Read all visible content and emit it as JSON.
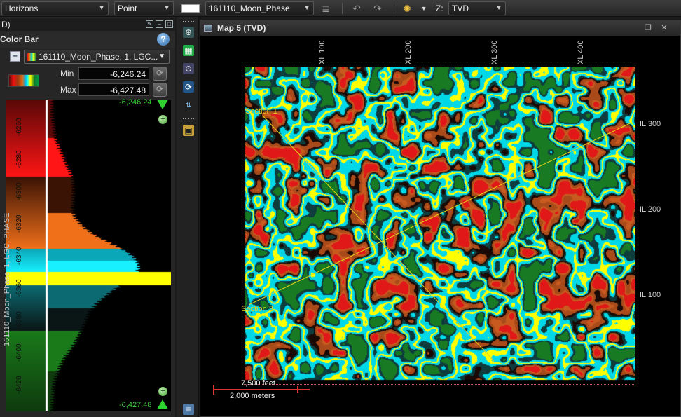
{
  "toolbar": {
    "horizons_label": "Horizons",
    "point_label": "Point",
    "attribute_label": "161110_Moon_Phase",
    "z_prefix": "Z:",
    "z_label": "TVD"
  },
  "left_panel": {
    "header_text": "D)",
    "title": "Color Bar",
    "attribute_select": "161110_Moon_Phase, 1, LGC...",
    "min_label": "Min",
    "min_value": "-6,246.24",
    "max_label": "Max",
    "max_value": "-6,427.48",
    "top_value": "-6,246.24",
    "bottom_value": "-6,427.48",
    "side_caption": "161110_Moon_Phase, 1, LGC, PHASE",
    "tick_labels": [
      "-6260",
      "-6280",
      "-6300",
      "-6320",
      "-6340",
      "-6360",
      "-6380",
      "-6400",
      "-6420"
    ]
  },
  "map": {
    "title": "Map 5 (TVD)",
    "xl_labels": [
      "XL 100",
      "XL 200",
      "XL 300",
      "XL 400"
    ],
    "il_labels": [
      "IL 300",
      "IL 200",
      "IL 100"
    ],
    "section_labels": [
      "Section 1",
      "Section 3"
    ],
    "scale_feet": "7,500 feet",
    "scale_meters": "2,000 meters"
  },
  "colors": {
    "ramp": [
      "#e01010",
      "#e46a10",
      "#18c8d8",
      "#ffff00",
      "#0e2a2a",
      "#1f8a1f"
    ],
    "map_palette": [
      "#ffff00",
      "#00d8e8",
      "#0f3d3d",
      "#a84a1a",
      "#1a0a05",
      "#e01818",
      "#187a22",
      "#c85a20"
    ]
  }
}
